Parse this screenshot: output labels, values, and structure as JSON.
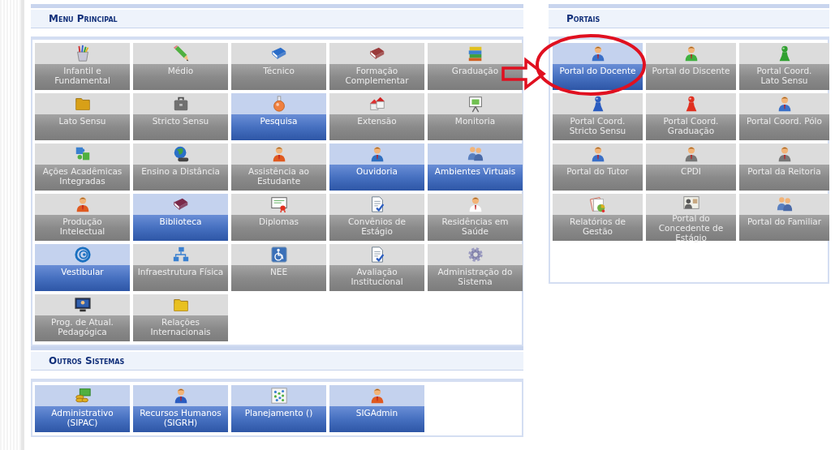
{
  "menu_principal": {
    "title": "Menu Principal",
    "tiles": [
      {
        "label": "Infantil e\nFundamental",
        "enabled": false
      },
      {
        "label": "Médio",
        "enabled": false
      },
      {
        "label": "Técnico",
        "enabled": false
      },
      {
        "label": "Formação\nComplementar",
        "enabled": false
      },
      {
        "label": "Graduação",
        "enabled": false
      },
      {
        "label": "Lato Sensu",
        "enabled": false
      },
      {
        "label": "Stricto Sensu",
        "enabled": false
      },
      {
        "label": "Pesquisa",
        "enabled": true
      },
      {
        "label": "Extensão",
        "enabled": false
      },
      {
        "label": "Monitoria",
        "enabled": false
      },
      {
        "label": "Ações Acadêmicas\nIntegradas",
        "enabled": false
      },
      {
        "label": "Ensino a Distância",
        "enabled": false
      },
      {
        "label": "Assistência ao\nEstudante",
        "enabled": false
      },
      {
        "label": "Ouvidoria",
        "enabled": true
      },
      {
        "label": "Ambientes Virtuais",
        "enabled": true
      },
      {
        "label": "Produção\nIntelectual",
        "enabled": false
      },
      {
        "label": "Biblioteca",
        "enabled": true
      },
      {
        "label": "Diplomas",
        "enabled": false
      },
      {
        "label": "Convênios de\nEstágio",
        "enabled": false
      },
      {
        "label": "Residências em\nSaúde",
        "enabled": false
      },
      {
        "label": "Vestibular",
        "enabled": true
      },
      {
        "label": "Infraestrutura Física",
        "enabled": false
      },
      {
        "label": "NEE",
        "enabled": false
      },
      {
        "label": "Avaliação\nInstitucional",
        "enabled": false
      },
      {
        "label": "Administração do\nSistema",
        "enabled": false
      },
      {
        "label": "Prog. de Atual.\nPedagógica",
        "enabled": false
      },
      {
        "label": "Relações\nInternacionais",
        "enabled": false
      }
    ]
  },
  "outros_sistemas": {
    "title": "Outros Sistemas",
    "tiles": [
      {
        "label": "Administrativo\n(SIPAC)",
        "enabled": true
      },
      {
        "label": "Recursos Humanos\n(SIGRH)",
        "enabled": true
      },
      {
        "label": "Planejamento ()",
        "enabled": true
      },
      {
        "label": "SIGAdmin",
        "enabled": true
      }
    ]
  },
  "portais": {
    "title": "Portais",
    "tiles": [
      {
        "label": "Portal do Docente",
        "enabled": true
      },
      {
        "label": "Portal do Discente",
        "enabled": false
      },
      {
        "label": "Portal Coord.\nLato Sensu",
        "enabled": false
      },
      {
        "label": "Portal Coord.\nStricto Sensu",
        "enabled": false
      },
      {
        "label": "Portal Coord.\nGraduação",
        "enabled": false
      },
      {
        "label": "Portal Coord. Pólo",
        "enabled": false
      },
      {
        "label": "Portal do Tutor",
        "enabled": false
      },
      {
        "label": "CPDI",
        "enabled": false
      },
      {
        "label": "Portal da Reitoria",
        "enabled": false
      },
      {
        "label": "Relatórios de\nGestão",
        "enabled": false
      },
      {
        "label": "Portal do\nConcedente de\nEstágio",
        "enabled": false
      },
      {
        "label": "Portal do Familiar",
        "enabled": false
      }
    ]
  }
}
